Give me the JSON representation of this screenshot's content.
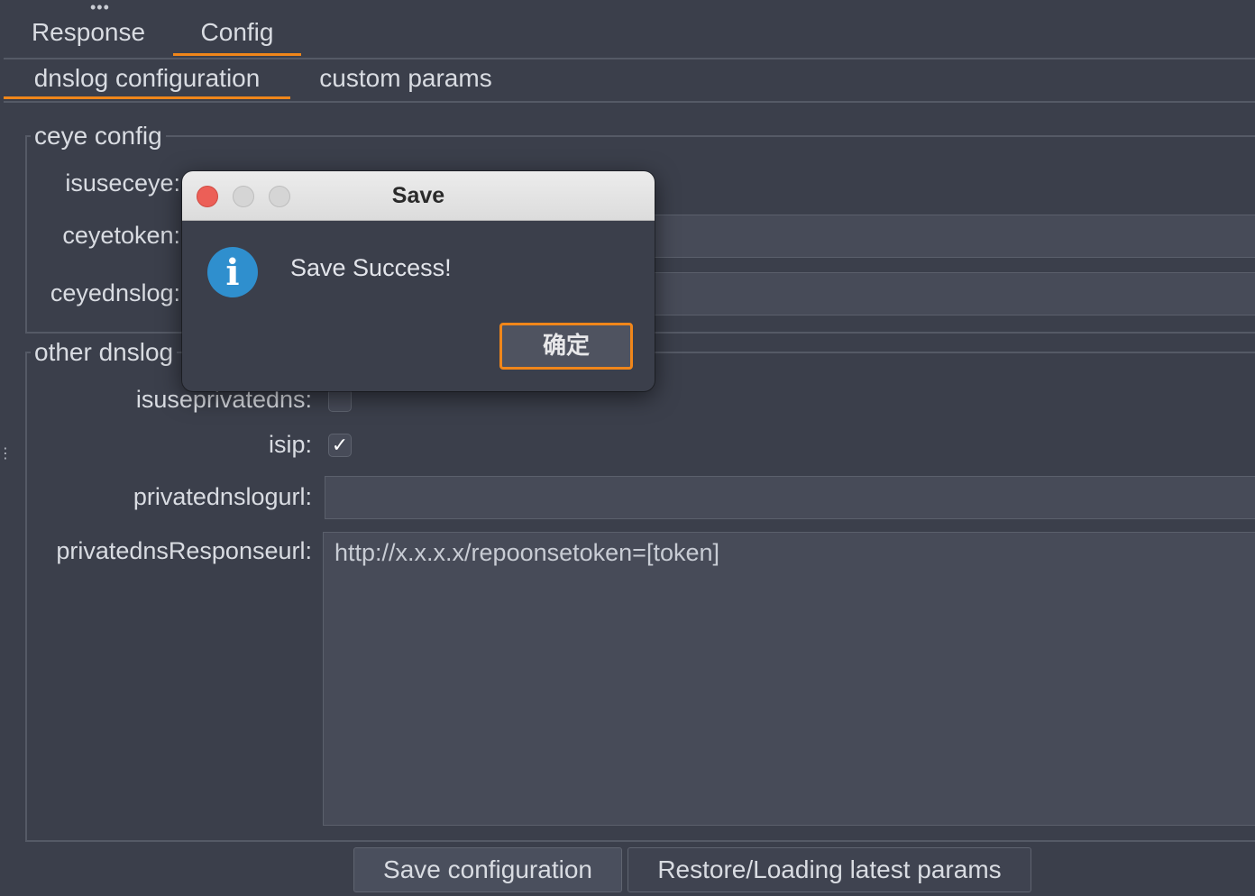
{
  "tabs": {
    "main": [
      {
        "label": "Response",
        "active": false
      },
      {
        "label": "Config",
        "active": true
      }
    ],
    "sub": [
      {
        "label": "dnslog configuration",
        "active": true
      },
      {
        "label": "custom params",
        "active": false
      }
    ]
  },
  "ceye": {
    "legend": "ceye config",
    "isuseceye_label": "isuseceye:",
    "ceyetoken_label": "ceyetoken:",
    "ceyednslog_label": "ceyednslog:",
    "ceyetoken_value": "",
    "ceyednslog_value": ""
  },
  "other": {
    "legend": "other dnslog",
    "isuseprivatedns_label": "isuseprivatedns:",
    "isuseprivatedns_checked": false,
    "isip_label": "isip:",
    "isip_checked": true,
    "privatednslogurl_label": "privatednslogurl:",
    "privatednslogurl_value": "",
    "privatednsResponseurl_label": "privatednsResponseurl:",
    "privatednsResponseurl_value": "http://x.x.x.x/repoonsetoken=[token]"
  },
  "buttons": {
    "save": "Save configuration",
    "restore": "Restore/Loading latest params"
  },
  "dialog": {
    "title": "Save",
    "message": "Save Success!",
    "ok": "确定"
  },
  "colors": {
    "background": "#3b3f4b",
    "accent": "#f0861a",
    "info": "#2f8fce",
    "close": "#ec5f57"
  },
  "icons": {
    "overflow": "ellipsis-icon",
    "dialog": "info-icon",
    "checkbox": "checkmark-icon"
  }
}
